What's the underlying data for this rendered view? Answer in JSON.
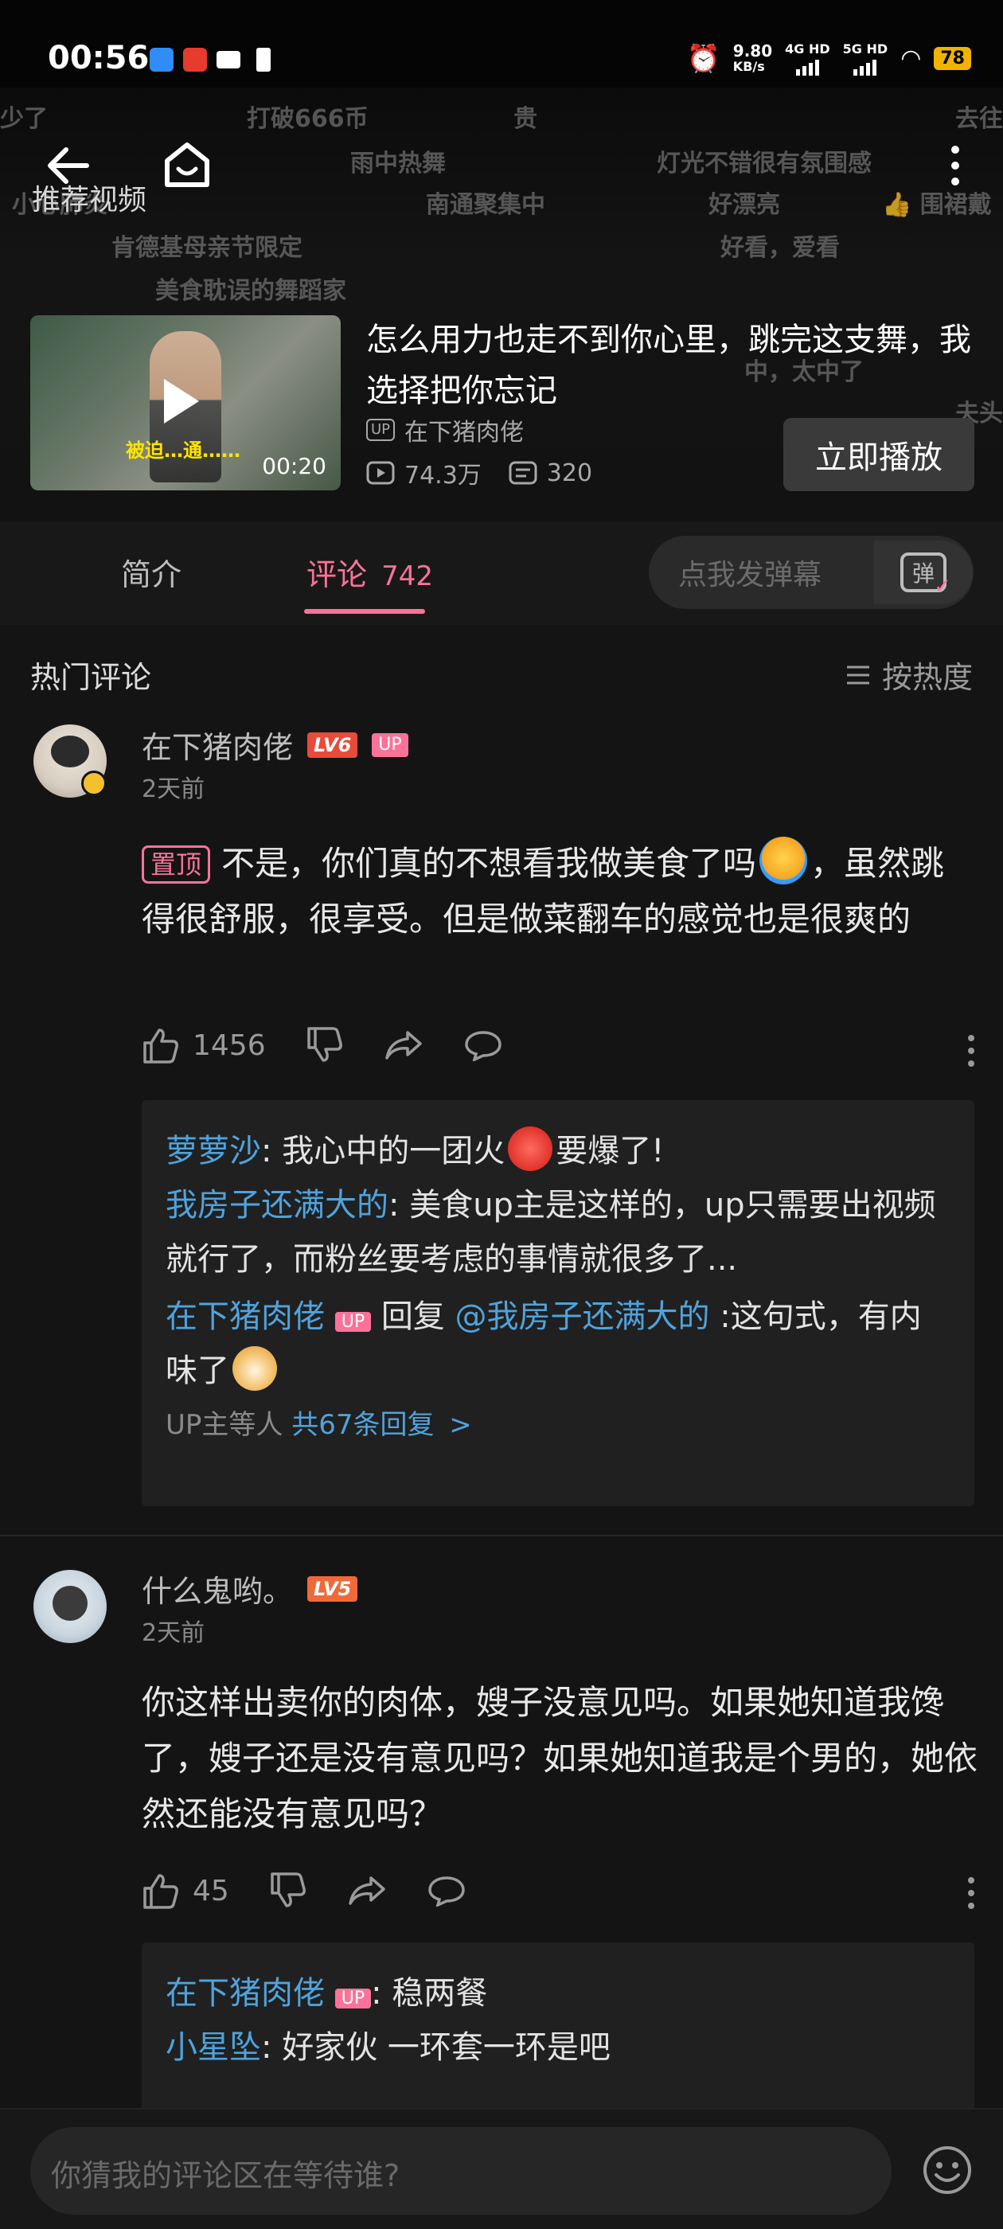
{
  "status_bar": {
    "time": "00:56",
    "net_speed": "9.80",
    "net_unit": "KB/s",
    "net1": "4G HD",
    "net2": "5G HD",
    "battery": "78"
  },
  "danmaku": [
    "少了",
    "打破666币",
    "贵",
    "去往",
    "雨中热舞",
    "灯光不错很有氛围感",
    "小心肺炎",
    "南通聚集中",
    "好漂亮",
    "👍 围裙戴",
    "肯德基母亲节限定",
    "好看，爱看",
    "美食耽误的舞蹈家",
    "中，太中了",
    "夫头"
  ],
  "recommend": {
    "label": "推荐视频",
    "thumb_caption": "被迫…通……",
    "duration": "00:20",
    "title": "怎么用力也走不到你心里，跳完这支舞，我选择把你忘记",
    "up_tag": "UP",
    "author": "在下猪肉佬",
    "views": "74.3万",
    "danmaku_count": "320",
    "play_button": "立即播放"
  },
  "tabs": {
    "intro": "简介",
    "comments": "评论",
    "comment_count": "742",
    "danmaku_placeholder": "点我发弹幕",
    "danmaku_btn": "弹"
  },
  "comments_header": {
    "title": "热门评论",
    "sort": "按热度"
  },
  "comments": [
    {
      "user": "在下猪肉佬",
      "level": "LV6",
      "up_badge": "UP",
      "time": "2天前",
      "pin": "置顶",
      "text_a": "不是，你们真的不想看我做美食了吗",
      "text_b": "，虽然跳得很舒服，很享受。但是做菜翻车的感觉也是很爽的",
      "likes": "1456",
      "replies": [
        {
          "name": "萝萝沙",
          "text_a": ": 我心中的一团火",
          "text_b": "要爆了!"
        },
        {
          "name": "我房子还满大的",
          "text": ": 美食up主是这样的，up只需要出视频就行了，而粉丝要考虑的事情就很多了..."
        },
        {
          "name": "在下猪肉佬",
          "up": "UP",
          "reply_word": "回复",
          "mention": "@我房子还满大的",
          "text_a": ":这句式，有内味了"
        }
      ],
      "more_prefix": "UP主等人",
      "more_link": "共67条回复"
    },
    {
      "user": "什么鬼哟。",
      "level": "LV5",
      "time": "2天前",
      "text": "你这样出卖你的肉体，嫂子没意见吗。如果她知道我馋了，嫂子还是没有意见吗？如果她知道我是个男的，她依然还能没有意见吗？",
      "likes": "45",
      "replies": [
        {
          "name": "在下猪肉佬",
          "up": "UP",
          "text": ": 稳两餐"
        },
        {
          "name": "小星坠",
          "text": ": 好家伙 一环套一环是吧"
        }
      ]
    }
  ],
  "bottom": {
    "placeholder": "你猜我的评论区在等待谁?"
  },
  "colors": {
    "accent_pink": "#fb7299",
    "link_blue": "#4fa3dd",
    "background": "#141414"
  }
}
